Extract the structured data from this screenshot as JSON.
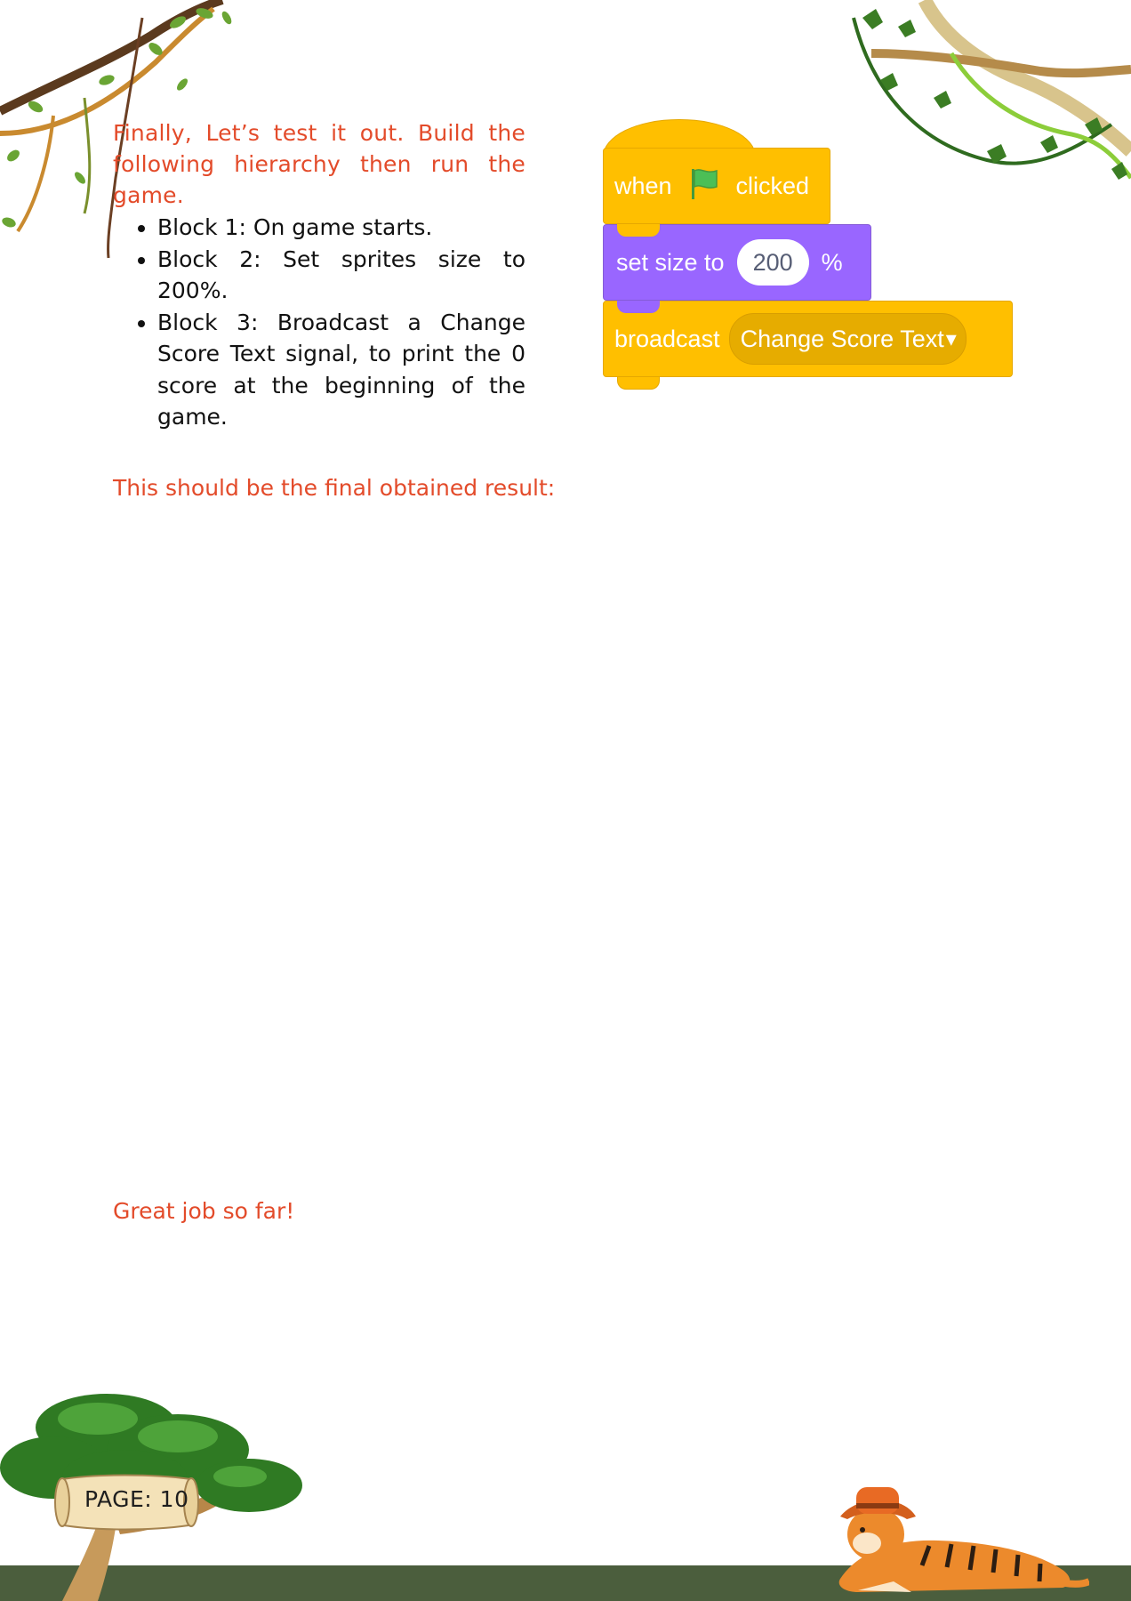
{
  "intro": "Finally, Let’s test it out. Build the following hierarchy then run the game.",
  "steps": [
    "Block 1: On game starts.",
    "Block 2: Set sprites size to 200%.",
    "Block 3: Broadcast a Change Score Text signal, to print the 0 score at the beginning of the game."
  ],
  "blocks": {
    "when": "when",
    "clicked": "clicked",
    "set_size": "set size to",
    "size_value": "200",
    "percent": "%",
    "broadcast": "broadcast",
    "message": "Change Score Text",
    "dropdown_arrow": "▾"
  },
  "result_label": "This should be the final obtained result:",
  "great_job": "Great job so far!",
  "page_label": "PAGE: 10",
  "colors": {
    "heading_red": "#e34b2a",
    "events_yellow": "#ffbf00",
    "looks_purple": "#9966ff",
    "ground_green": "#4b5e3d"
  },
  "icons": [
    "vine-top-left",
    "vine-top-right",
    "tree-icon",
    "green-flag-icon",
    "tiger-icon",
    "scroll-icon"
  ]
}
